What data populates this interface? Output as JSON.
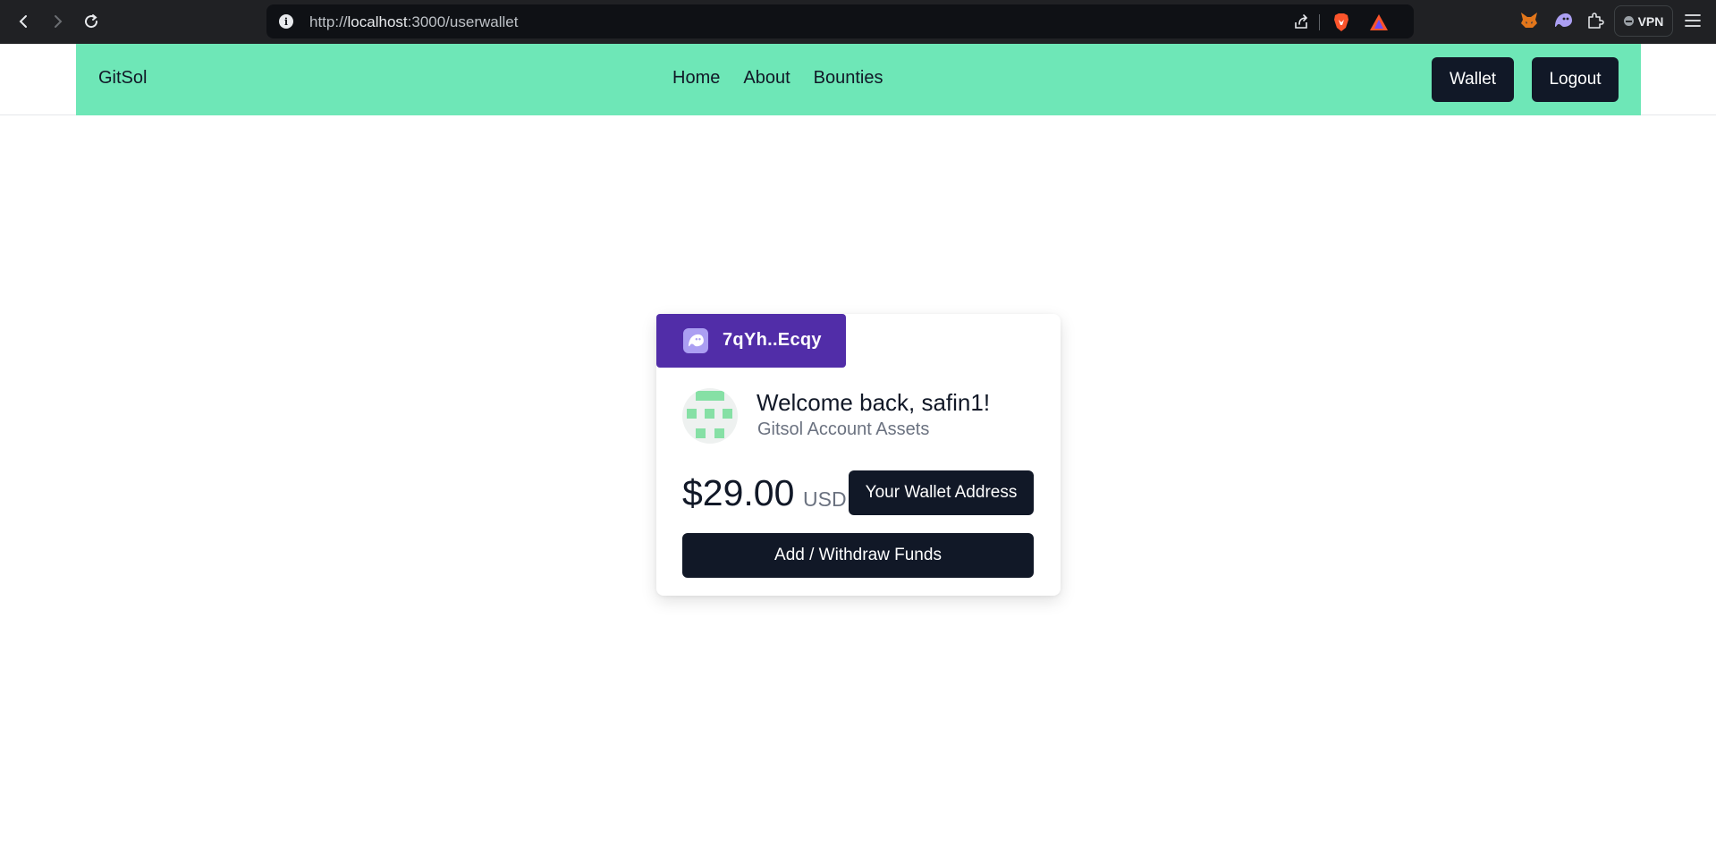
{
  "browser": {
    "url_prefix": "http://",
    "url_host": "localhost",
    "url_rest": ":3000/userwallet",
    "vpn_label": "VPN"
  },
  "navbar": {
    "brand": "GitSol",
    "links": [
      "Home",
      "About",
      "Bounties"
    ],
    "wallet_label": "Wallet",
    "logout_label": "Logout",
    "bg_color": "#6ee7b7"
  },
  "card": {
    "wallet_short": "7qYh..Ecqy",
    "welcome": "Welcome back, safin1!",
    "subtitle": "Gitsol Account Assets",
    "balance": "$29.00",
    "currency": "USD",
    "wallet_address_label": "Your Wallet Address",
    "funds_label": "Add / Withdraw Funds",
    "accent_color": "#512da8",
    "button_color": "#111827"
  }
}
